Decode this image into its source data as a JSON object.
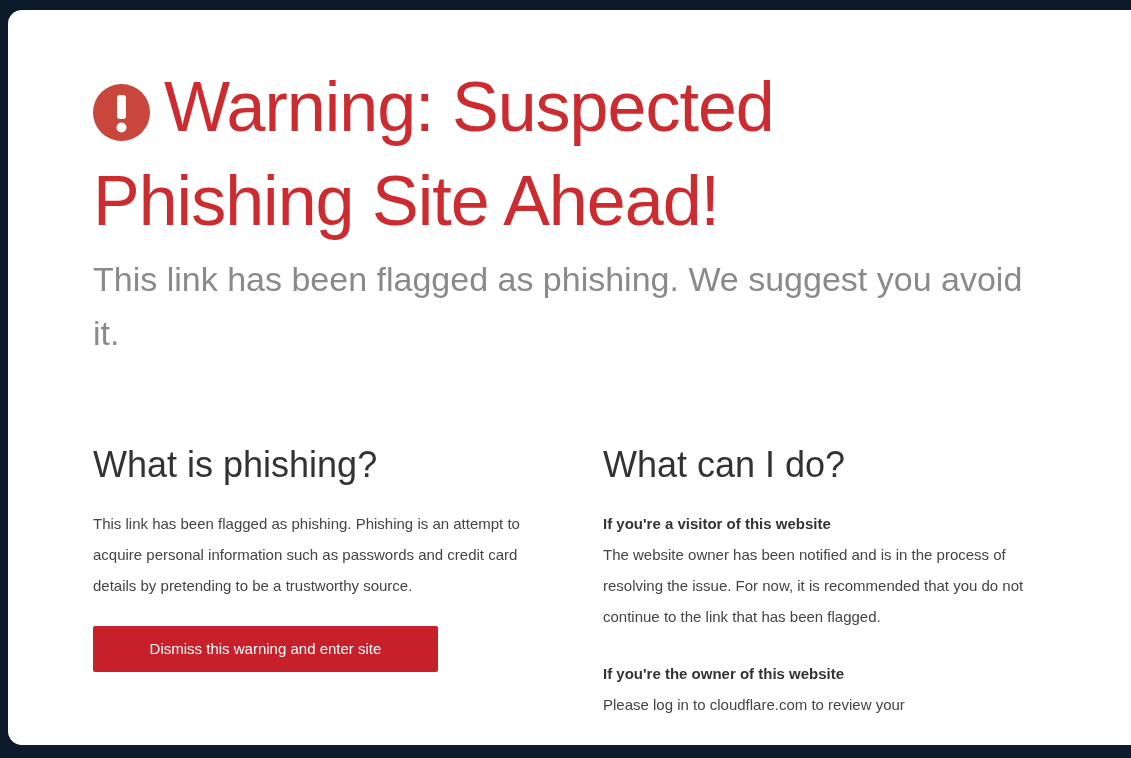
{
  "warning": {
    "title_lines": [
      "Warning: Suspected",
      "Phishing Site Ahead!"
    ],
    "subtitle": "This link has been flagged as phishing. We suggest you avoid it."
  },
  "left": {
    "heading": "What is phishing?",
    "body": "This link has been flagged as phishing. Phishing is an attempt to acquire personal information such as passwords and credit card details by pretending to be a trustworthy source.",
    "button": "Dismiss this warning and enter site"
  },
  "right": {
    "heading": "What can I do?",
    "sections": [
      {
        "title": "If you're a visitor of this website",
        "body": "The website owner has been notified and is in the process of resolving the issue. For now, it is recommended that you do not continue to the link that has been flagged."
      },
      {
        "title": "If you're the owner of this website",
        "body": "Please log in to cloudflare.com to review your"
      }
    ]
  }
}
